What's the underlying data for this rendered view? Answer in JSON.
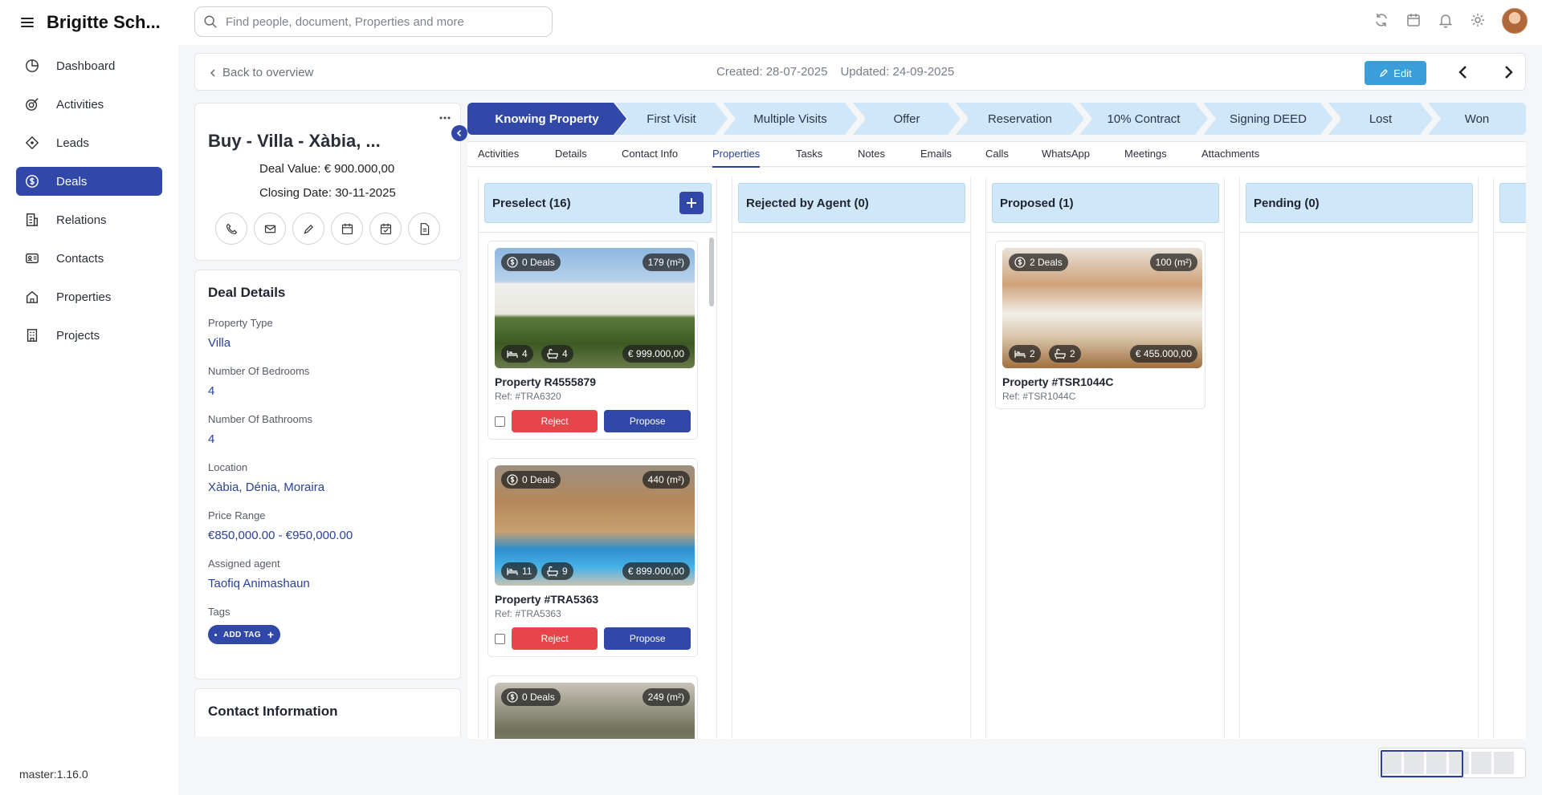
{
  "sidebar": {
    "brand": "Brigitte Sch...",
    "items": [
      {
        "label": "Dashboard",
        "icon": "dashboard-icon"
      },
      {
        "label": "Activities",
        "icon": "activities-icon"
      },
      {
        "label": "Leads",
        "icon": "leads-icon"
      },
      {
        "label": "Deals",
        "icon": "deals-icon",
        "active": true
      },
      {
        "label": "Relations",
        "icon": "relations-icon"
      },
      {
        "label": "Contacts",
        "icon": "contacts-icon"
      },
      {
        "label": "Properties",
        "icon": "properties-icon"
      },
      {
        "label": "Projects",
        "icon": "projects-icon"
      }
    ],
    "version": "master:1.16.0"
  },
  "topbar": {
    "search_placeholder": "Find people, document, Properties and more"
  },
  "header": {
    "back_label": "Back to overview",
    "created": "Created: 28-07-2025",
    "updated": "Updated: 24-09-2025",
    "edit_label": "Edit"
  },
  "deal": {
    "title": "Buy - Villa - Xàbia, ...",
    "value": "Deal Value:  € 900.000,00",
    "closing": "Closing Date: 30-11-2025"
  },
  "details": {
    "heading": "Deal Details",
    "fields": [
      {
        "label": "Property Type",
        "value": "Villa"
      },
      {
        "label": "Number Of Bedrooms",
        "value": "4"
      },
      {
        "label": "Number Of Bathrooms",
        "value": "4"
      },
      {
        "label": "Location",
        "value": "Xàbia, Dénia, Moraira"
      },
      {
        "label": "Price Range",
        "value": "€850,000.00 - €950,000.00"
      },
      {
        "label": "Assigned agent",
        "value": "Taofiq Animashaun"
      }
    ],
    "tags_label": "Tags",
    "add_tag": "ADD TAG"
  },
  "contact": {
    "heading": "Contact Information"
  },
  "pipeline": {
    "stages": [
      "Knowing Property",
      "First Visit",
      "Multiple Visits",
      "Offer",
      "Reservation",
      "10% Contract",
      "Signing DEED",
      "Lost",
      "Won"
    ],
    "active_index": 0
  },
  "tabs": [
    "Activities",
    "Details",
    "Contact Info",
    "Properties",
    "Tasks",
    "Notes",
    "Emails",
    "Calls",
    "WhatsApp",
    "Meetings",
    "Attachments"
  ],
  "active_tab": "Properties",
  "board": {
    "columns": [
      {
        "title": "Preselect (16)"
      },
      {
        "title": "Rejected by Agent (0)"
      },
      {
        "title": "Proposed (1)"
      },
      {
        "title": "Pending (0)"
      }
    ],
    "preselect_cards": [
      {
        "deals": "0 Deals",
        "area": "179 (m²)",
        "beds": "4",
        "baths": "4",
        "price": "€ 999.000,00",
        "title": "Property R4555879",
        "ref": "Ref: #TRA6320"
      },
      {
        "deals": "0 Deals",
        "area": "440 (m²)",
        "beds": "11",
        "baths": "9",
        "price": "€ 899.000,00",
        "title": "Property #TRA5363",
        "ref": "Ref: #TRA5363"
      },
      {
        "deals": "0 Deals",
        "area": "249 (m²)"
      }
    ],
    "proposed_cards": [
      {
        "deals": "2 Deals",
        "area": "100 (m²)",
        "beds": "2",
        "baths": "2",
        "price": "€ 455.000,00",
        "title": "Property #TSR1044C",
        "ref": "Ref: #TSR1044C"
      }
    ],
    "reject_label": "Reject",
    "propose_label": "Propose"
  }
}
